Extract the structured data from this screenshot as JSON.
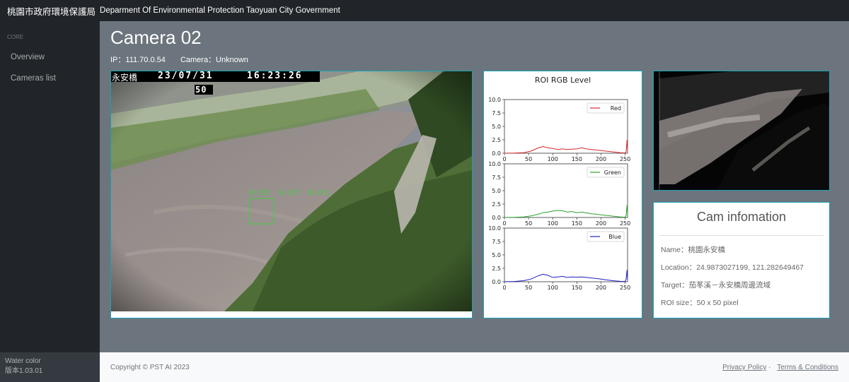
{
  "topbar": {
    "brand_zh": "桃園市政府環境保護局",
    "brand_en": "Deparment Of Environmental Protection Taoyuan City Government"
  },
  "sidebar": {
    "section": "CORE",
    "items": [
      {
        "label": "Overview"
      },
      {
        "label": "Cameras list"
      }
    ],
    "footer_line1": "Water color",
    "footer_line2": "版本1.03.01"
  },
  "page": {
    "title": "Camera 02",
    "ip": "IP：111.70.0.54",
    "camera": "Camera：Unknown"
  },
  "camera_view": {
    "osd_location": "永安橋",
    "osd_date": "23/07/31",
    "osd_time": "16:23:26",
    "osd_roi": "50",
    "roi_readout": "R:215  G:217  B:211"
  },
  "info": {
    "title": "Cam infomation",
    "name": "Name：桃園永安橋",
    "location": "Location：24.9873027199, 121.282649467",
    "target": "Target：茄苳溪－永安橋周邊流域",
    "roi_size": "ROI size：50 x 50 pixel"
  },
  "footer": {
    "copyright": "Copyright © PST AI 2023",
    "privacy": "Privacy Policy",
    "terms": "Terms & Conditions"
  },
  "colors": {
    "red": "#d62728",
    "green": "#2ca02c",
    "blue": "#1f1fbf",
    "accent": "#17a2b8"
  },
  "chart_data": {
    "type": "line",
    "title": "ROI RGB Level",
    "xlabel": "",
    "ylabel": "",
    "xlim": [
      0,
      255
    ],
    "ylim": [
      0,
      10
    ],
    "x_ticks": [
      "0",
      "50",
      "100",
      "150",
      "200",
      "250"
    ],
    "y_ticks": [
      "0.0",
      "2.5",
      "5.0",
      "7.5",
      "10.0"
    ],
    "series": [
      {
        "name": "Red",
        "color": "#d62728",
        "points": [
          [
            0,
            0
          ],
          [
            20,
            0.02
          ],
          [
            40,
            0.1
          ],
          [
            55,
            0.4
          ],
          [
            70,
            1.0
          ],
          [
            80,
            1.25
          ],
          [
            90,
            1.0
          ],
          [
            100,
            0.9
          ],
          [
            110,
            0.7
          ],
          [
            120,
            0.8
          ],
          [
            130,
            0.7
          ],
          [
            140,
            0.75
          ],
          [
            150,
            0.8
          ],
          [
            160,
            1.0
          ],
          [
            170,
            0.8
          ],
          [
            180,
            0.7
          ],
          [
            190,
            0.6
          ],
          [
            200,
            0.5
          ],
          [
            210,
            0.4
          ],
          [
            220,
            0.3
          ],
          [
            230,
            0.2
          ],
          [
            240,
            0.1
          ],
          [
            250,
            0.05
          ],
          [
            252,
            0.3
          ],
          [
            254,
            2.5
          ],
          [
            255,
            0.5
          ]
        ]
      },
      {
        "name": "Green",
        "color": "#2ca02c",
        "points": [
          [
            0,
            0
          ],
          [
            20,
            0.02
          ],
          [
            40,
            0.1
          ],
          [
            55,
            0.3
          ],
          [
            70,
            0.6
          ],
          [
            80,
            0.9
          ],
          [
            90,
            1.0
          ],
          [
            100,
            1.2
          ],
          [
            110,
            1.3
          ],
          [
            120,
            1.25
          ],
          [
            130,
            1.0
          ],
          [
            140,
            1.1
          ],
          [
            150,
            0.9
          ],
          [
            160,
            1.0
          ],
          [
            170,
            0.85
          ],
          [
            180,
            0.7
          ],
          [
            190,
            0.6
          ],
          [
            200,
            0.5
          ],
          [
            210,
            0.4
          ],
          [
            220,
            0.3
          ],
          [
            230,
            0.2
          ],
          [
            240,
            0.1
          ],
          [
            250,
            0.05
          ],
          [
            252,
            0.4
          ],
          [
            254,
            2.3
          ],
          [
            255,
            0.5
          ]
        ]
      },
      {
        "name": "Blue",
        "color": "#1f1fbf",
        "points": [
          [
            0,
            0
          ],
          [
            20,
            0.05
          ],
          [
            40,
            0.2
          ],
          [
            55,
            0.5
          ],
          [
            70,
            1.1
          ],
          [
            80,
            1.4
          ],
          [
            90,
            1.2
          ],
          [
            100,
            0.8
          ],
          [
            110,
            0.9
          ],
          [
            120,
            1.0
          ],
          [
            130,
            0.8
          ],
          [
            140,
            0.9
          ],
          [
            150,
            0.85
          ],
          [
            160,
            0.9
          ],
          [
            170,
            0.8
          ],
          [
            180,
            0.7
          ],
          [
            190,
            0.6
          ],
          [
            200,
            0.5
          ],
          [
            210,
            0.35
          ],
          [
            220,
            0.25
          ],
          [
            230,
            0.15
          ],
          [
            240,
            0.08
          ],
          [
            250,
            0.05
          ],
          [
            252,
            0.5
          ],
          [
            254,
            2.2
          ],
          [
            255,
            0.4
          ]
        ]
      }
    ]
  }
}
